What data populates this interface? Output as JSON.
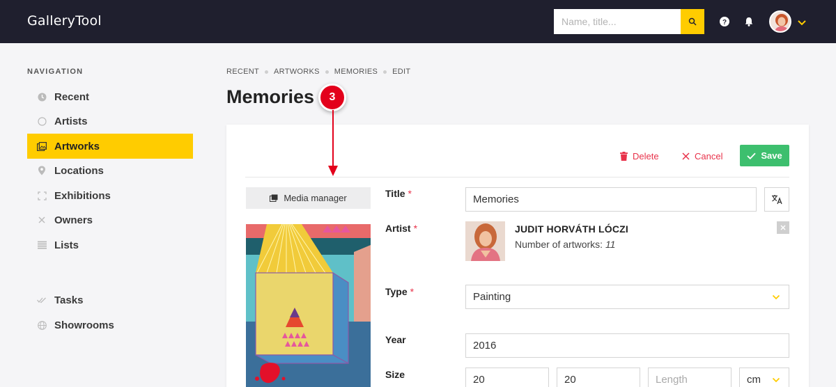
{
  "app": {
    "brand": "GalleryTool"
  },
  "search": {
    "placeholder": "Name, title..."
  },
  "header_icons": [
    "search-icon",
    "help-icon",
    "bell-icon",
    "user-avatar",
    "chevron-down-icon"
  ],
  "colors": {
    "accent": "#ffcc00",
    "topbar": "#1f1f2e",
    "danger": "#e8324a",
    "save": "#3dbf6e",
    "callout": "#e3001b"
  },
  "sidebar": {
    "heading": "NAVIGATION",
    "items": [
      {
        "label": "Recent",
        "icon": "clock-icon"
      },
      {
        "label": "Artists",
        "icon": "circle-icon"
      },
      {
        "label": "Artworks",
        "icon": "image-icon",
        "active": true
      },
      {
        "label": "Locations",
        "icon": "map-pin-icon"
      },
      {
        "label": "Exhibitions",
        "icon": "frame-icon"
      },
      {
        "label": "Owners",
        "icon": "x-icon"
      },
      {
        "label": "Lists",
        "icon": "list-icon"
      },
      {
        "label": "Tasks",
        "icon": "double-check-icon"
      },
      {
        "label": "Showrooms",
        "icon": "globe-icon"
      }
    ]
  },
  "breadcrumb": [
    "RECENT",
    "ARTWORKS",
    "MEMORIES",
    "EDIT"
  ],
  "page": {
    "title": "Memories"
  },
  "callout": {
    "number": "3"
  },
  "actions": {
    "delete": "Delete",
    "cancel": "Cancel",
    "save": "Save"
  },
  "media_manager": {
    "label": "Media manager"
  },
  "form": {
    "title_label": "Title",
    "title_value": "Memories",
    "artist_label": "Artist",
    "artist_name": "JUDIT HORVÁTH LÓCZI",
    "artist_count_label": "Number of artworks:",
    "artist_count": "11",
    "type_label": "Type",
    "type_value": "Painting",
    "year_label": "Year",
    "year_value": "2016",
    "size_label": "Size",
    "size_width": "20",
    "size_height": "20",
    "size_length_placeholder": "Length",
    "size_unit": "cm",
    "required_mark": "*"
  }
}
